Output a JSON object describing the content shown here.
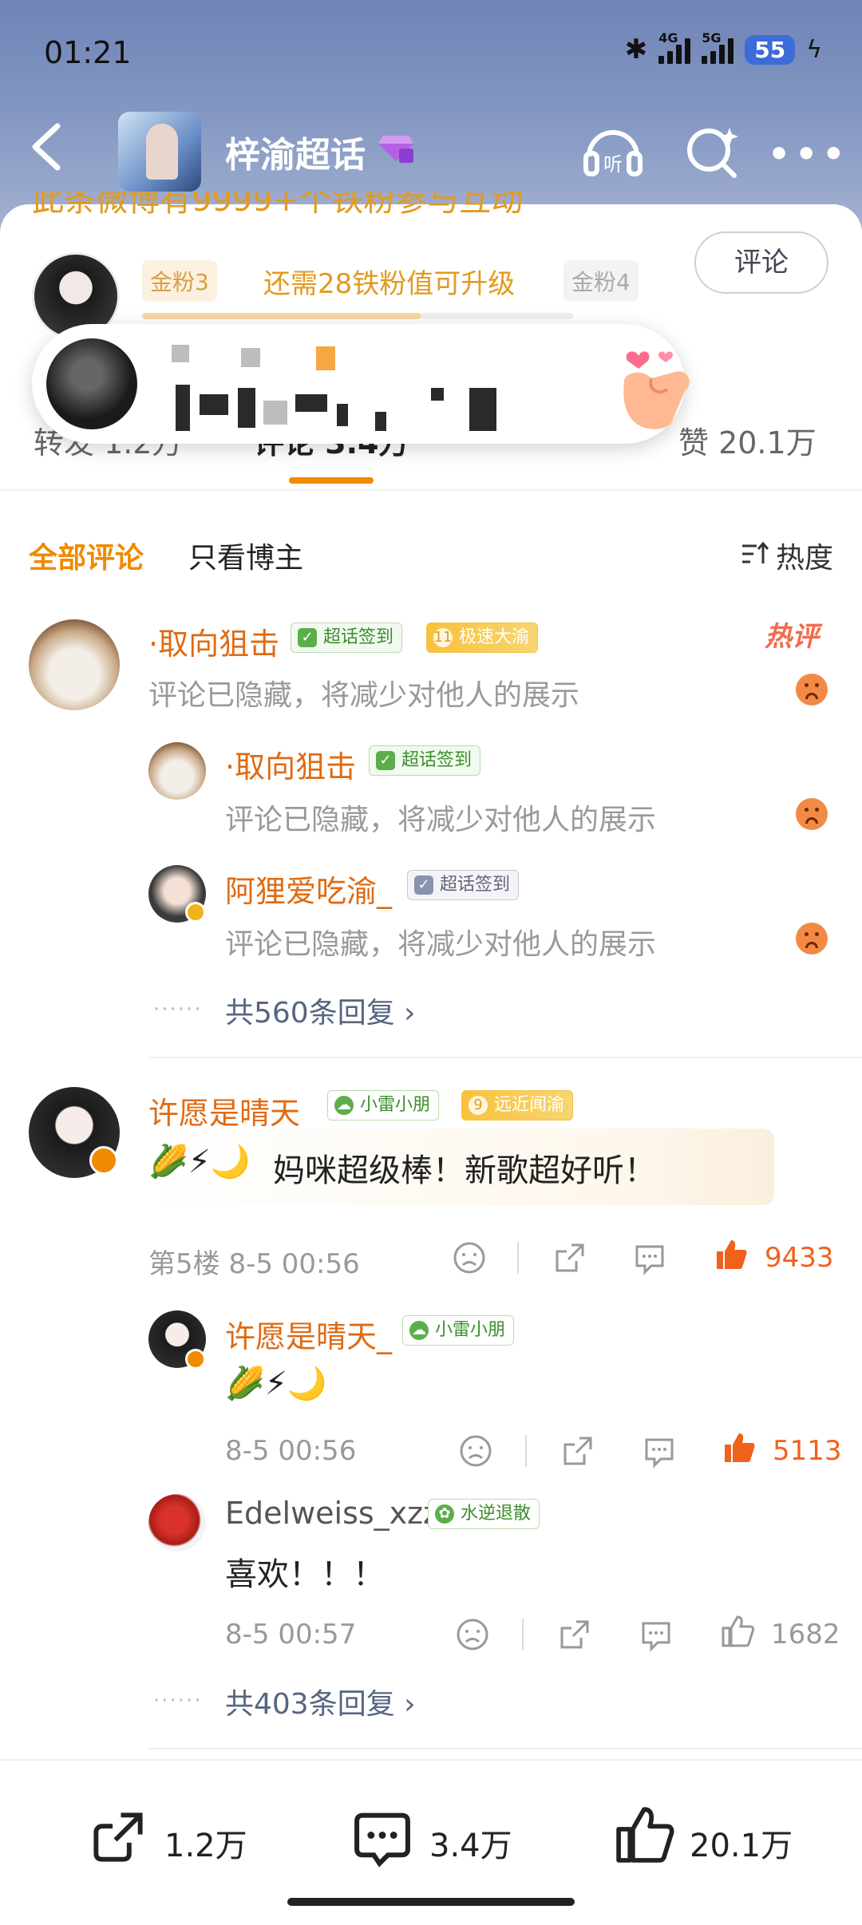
{
  "status_bar": {
    "time": "01:21",
    "network_a": "4G",
    "network_b": "5G",
    "battery": "55"
  },
  "topnav": {
    "title": "梓渝超话"
  },
  "post": {
    "cut_text": "此条微博有9999+个铁粉参与互动",
    "fan_level_from": "金粉3",
    "fan_level_to": "金粉4",
    "upgrade_hint": "还需28铁粉值可升级",
    "comment_button": "评论"
  },
  "tabs": {
    "repost": "转发 1.2万",
    "comments": "评论 3.4万",
    "likes": "赞 20.1万"
  },
  "filter": {
    "all": "全部评论",
    "owner_only": "只看博主",
    "sort": "热度"
  },
  "comments": [
    {
      "user": "·取向狙击",
      "badges": [
        "超话签到",
        "极速大渝"
      ],
      "badge_level": "11",
      "text": "评论已隐藏，将减少对他人的展示",
      "hot_label": "热评",
      "replies": [
        {
          "user": "·取向狙击",
          "badge": "超话签到",
          "text": "评论已隐藏，将减少对他人的展示"
        },
        {
          "user": "阿狸爱吃渝_",
          "badge": "超话签到",
          "text": "评论已隐藏，将减少对他人的展示"
        }
      ],
      "more_replies": "共560条回复 ›"
    },
    {
      "user": "许愿是晴天_",
      "badges": [
        "小雷小朋",
        "远近闻渝"
      ],
      "badge_level": "9",
      "emoji": "🌽⚡🌙",
      "text": "妈咪超级棒！新歌超好听！",
      "floor_time": "第5楼 8-5 00:56",
      "likes": "9433",
      "replies": [
        {
          "user": "许愿是晴天_",
          "badge": "小雷小朋",
          "text": "🌽⚡🌙",
          "time": "8-5 00:56",
          "likes": "5113"
        },
        {
          "user": "Edelweiss_xzz",
          "badge": "水逆退散",
          "text": "喜欢！！！",
          "time": "8-5 00:57",
          "likes": "1682"
        }
      ],
      "more_replies": "共403条回复 ›"
    }
  ],
  "bottom_bar": {
    "repost": "1.2万",
    "comment": "3.4万",
    "like": "20.1万"
  },
  "colors": {
    "accent": "#f08a00",
    "username": "#e06a12",
    "like_active": "#f0611c"
  }
}
